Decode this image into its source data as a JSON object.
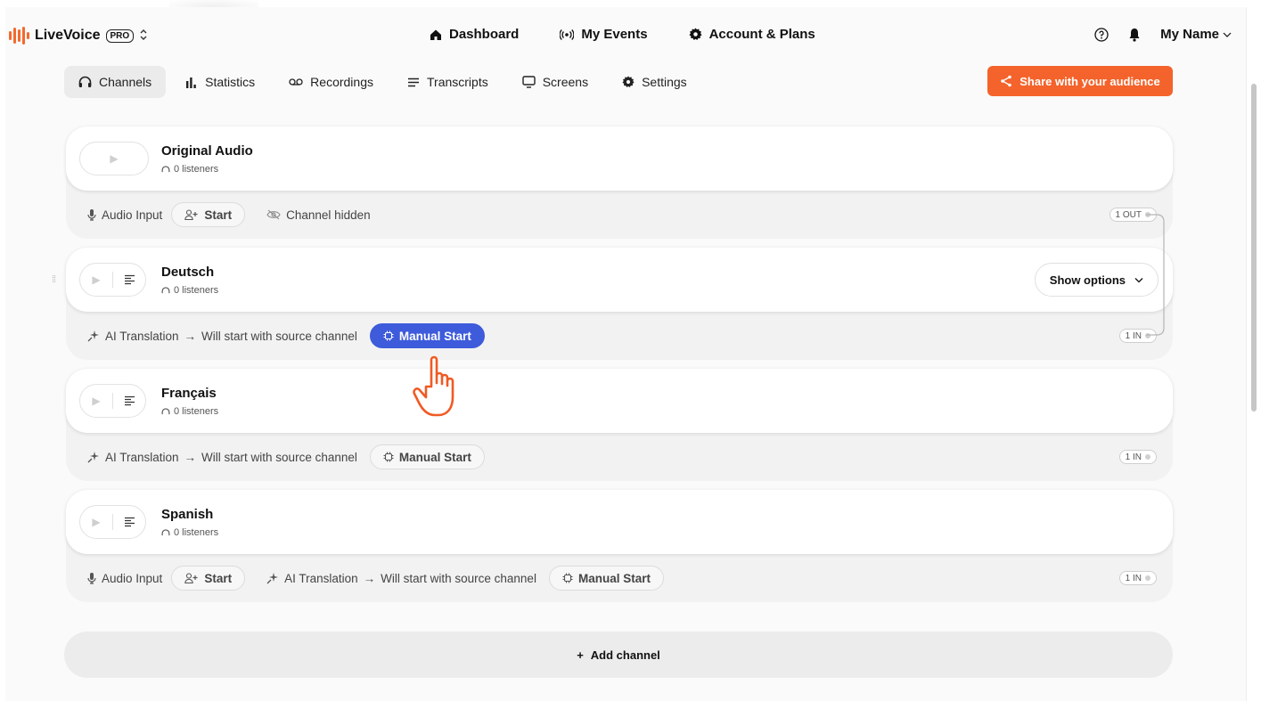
{
  "brand": {
    "name": "LiveVoice",
    "badge": "PRO",
    "switcher": "⌃⌄",
    "logo_color": "#f26a2e"
  },
  "main_nav": [
    {
      "label": "Dashboard",
      "icon": "home-icon"
    },
    {
      "label": "My Events",
      "icon": "broadcast-icon"
    },
    {
      "label": "Account & Plans",
      "icon": "gear-icon"
    }
  ],
  "top_right": {
    "help_icon": "help-circle-icon",
    "bell_icon": "bell-icon",
    "user_name": "My Name",
    "caret": "⌄"
  },
  "sub_nav": [
    {
      "label": "Channels",
      "icon": "headphones-icon",
      "active": true
    },
    {
      "label": "Statistics",
      "icon": "bar-chart-icon",
      "active": false
    },
    {
      "label": "Recordings",
      "icon": "voicemail-icon",
      "active": false
    },
    {
      "label": "Transcripts",
      "icon": "lines-icon",
      "active": false
    },
    {
      "label": "Screens",
      "icon": "monitor-icon",
      "active": false
    },
    {
      "label": "Settings",
      "icon": "gear-icon",
      "active": false
    }
  ],
  "share": {
    "label": "Share with your audience",
    "color": "#f4632b"
  },
  "channels": [
    {
      "title": "Original Audio",
      "listeners": "0 listeners",
      "audio_input_label": "Audio Input",
      "start_label": "Start",
      "hidden_label": "Channel hidden",
      "io": "1 OUT"
    },
    {
      "title": "Deutsch",
      "listeners": "0 listeners",
      "show_options": "Show options",
      "ai_label": "AI Translation",
      "arrow": "→",
      "will_start": "Will start with source channel",
      "manual_start": "Manual Start",
      "io": "1 IN"
    },
    {
      "title": "Français",
      "listeners": "0 listeners",
      "ai_label": "AI Translation",
      "arrow": "→",
      "will_start": "Will start with source channel",
      "manual_start": "Manual Start",
      "io": "1 IN"
    },
    {
      "title": "Spanish",
      "listeners": "0 listeners",
      "audio_input_label": "Audio Input",
      "start_label": "Start",
      "ai_label": "AI Translation",
      "arrow": "→",
      "will_start": "Will start with source channel",
      "manual_start": "Manual Start",
      "io": "1 IN"
    }
  ],
  "add_channel": {
    "plus": "+",
    "label": "Add channel"
  },
  "colors": {
    "accent_blue": "#3d5bdb",
    "accent_orange": "#f4632b"
  }
}
